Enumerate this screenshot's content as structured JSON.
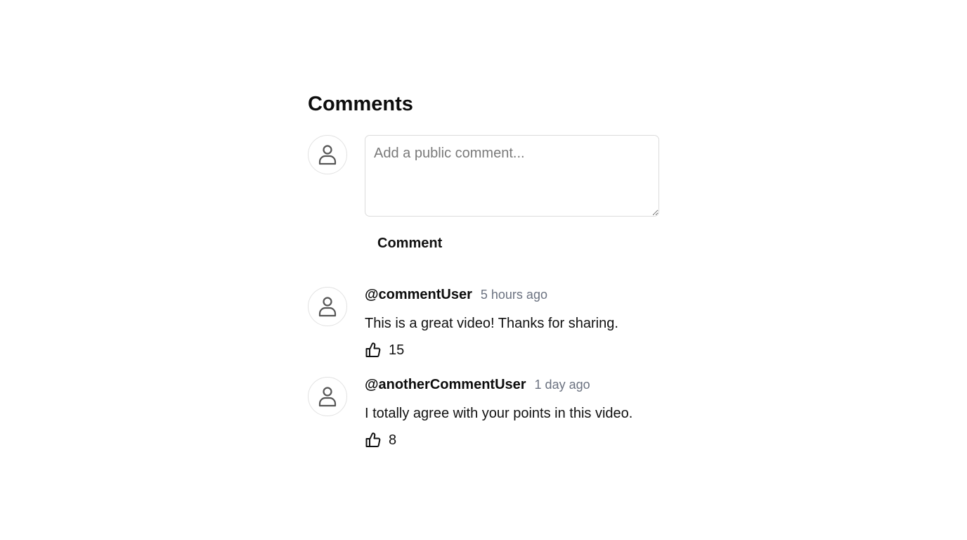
{
  "comments_section": {
    "title": "Comments",
    "composer": {
      "avatar_icon": "user-icon",
      "placeholder": "Add a public comment...",
      "value": "",
      "submit_label": "Comment"
    },
    "comments": [
      {
        "username": "@commentUser",
        "timestamp": "5 hours ago",
        "text": "This is a great video! Thanks for sharing.",
        "likes": "15",
        "avatar_icon": "user-icon",
        "like_icon": "thumbs-up-icon"
      },
      {
        "username": "@anotherCommentUser",
        "timestamp": "1 day ago",
        "text": "I totally agree with your points in this video.",
        "likes": "8",
        "avatar_icon": "user-icon",
        "like_icon": "thumbs-up-icon"
      }
    ]
  },
  "colors": {
    "text": "#111111",
    "muted": "#6b7280",
    "border": "#dcdcdc",
    "icon": "#555555"
  }
}
